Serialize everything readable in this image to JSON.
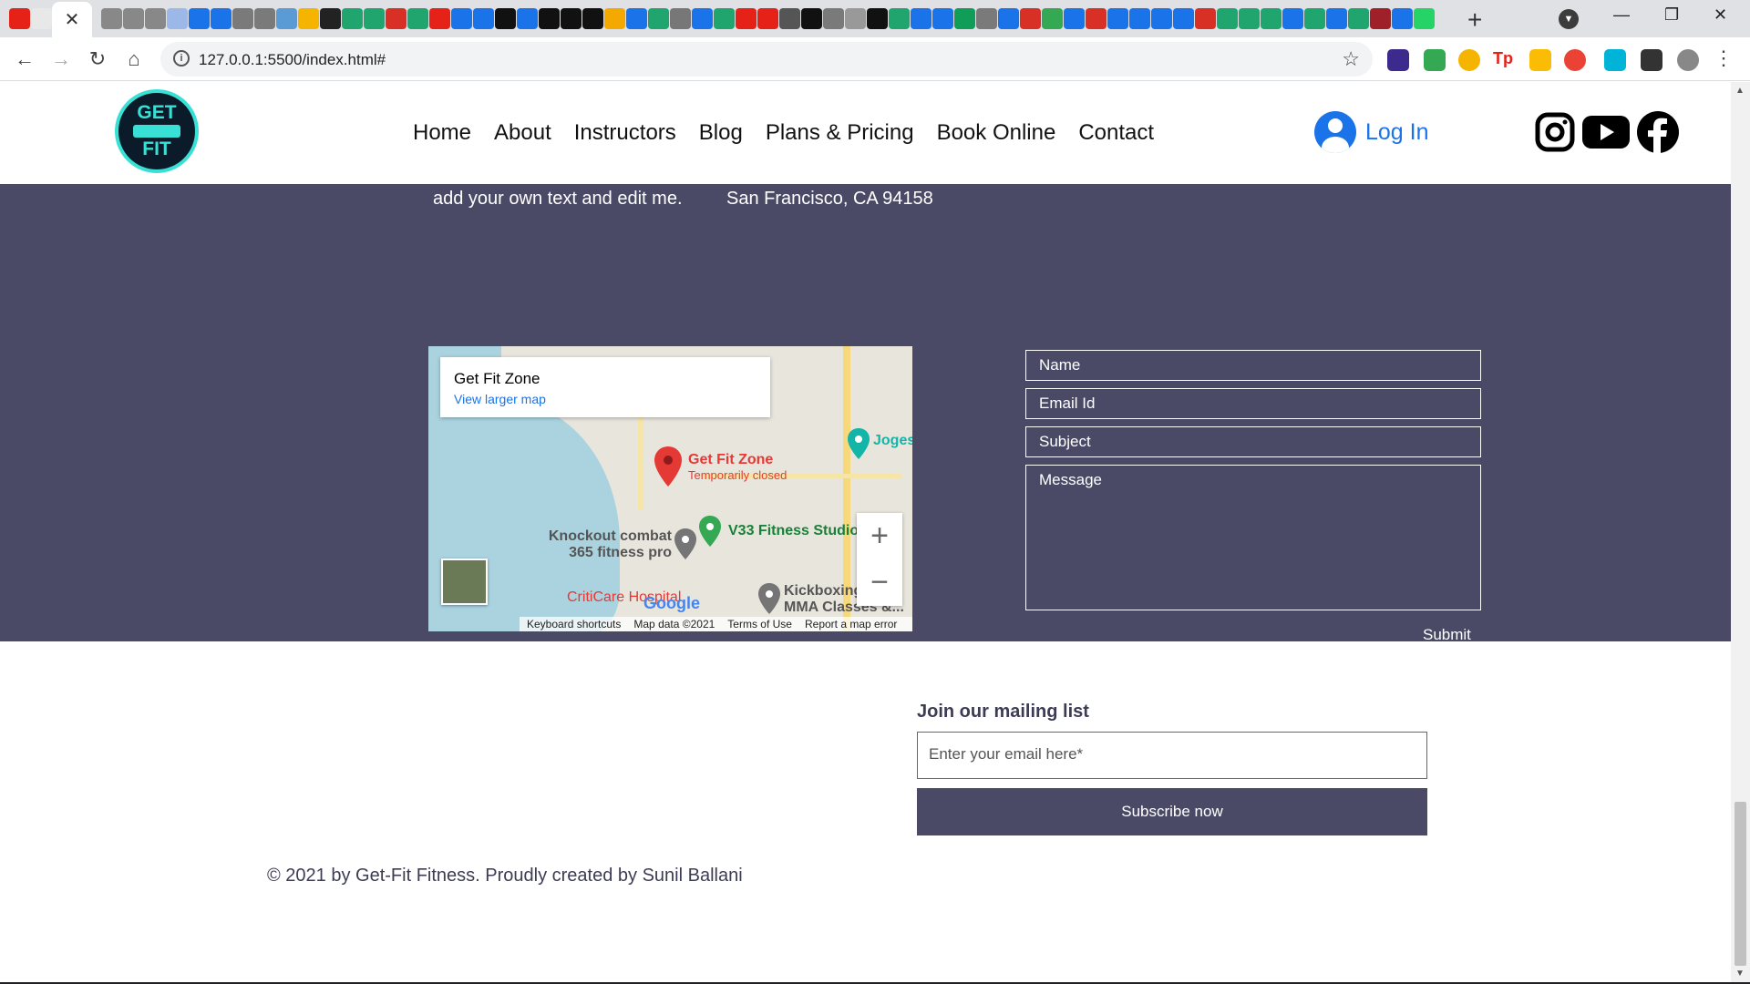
{
  "browser": {
    "active_tab_close": "✕",
    "new_tab": "+",
    "url": "127.0.0.1:5500/index.html#",
    "tab_icon_colors": [
      "#e62117",
      "#e8e8e8",
      "#888",
      "#888",
      "#888",
      "#9bb8e8",
      "#1a73e8",
      "#1a73e8",
      "#7a7a7a",
      "#7a7a7a",
      "#5b9bd5",
      "#f4b400",
      "#222",
      "#21a56f",
      "#21a56f",
      "#d93025",
      "#21a56f",
      "#e62117",
      "#1a73e8",
      "#1a73e8",
      "#111",
      "#1a73e8",
      "#111",
      "#111",
      "#111",
      "#f4a900",
      "#1a73e8",
      "#21a56f",
      "#777",
      "#1a73e8",
      "#21a56f",
      "#e62117",
      "#e62117",
      "#555",
      "#111",
      "#7a7a7a",
      "#999",
      "#111",
      "#21a56f",
      "#1a73e8",
      "#1a73e8",
      "#0f9d58",
      "#7a7a7a",
      "#1a73e8",
      "#d93025",
      "#34a853",
      "#1a73e8",
      "#d93025",
      "#1a73e8",
      "#1a73e8",
      "#1a73e8",
      "#1a73e8",
      "#d93025",
      "#21a56f",
      "#21a56f",
      "#21a56f",
      "#1a73e8",
      "#21a56f",
      "#1a73e8",
      "#21a56f",
      "#a0202a",
      "#1a73e8",
      "#25d366"
    ]
  },
  "site": {
    "logo_top": "GET",
    "logo_bottom": "FIT",
    "nav": [
      "Home",
      "About",
      "Instructors",
      "Blog",
      "Plans & Pricing",
      "Book Online",
      "Contact"
    ],
    "login": "Log In",
    "socials": [
      "instagram-icon",
      "youtube-icon",
      "facebook-icon"
    ]
  },
  "contact": {
    "col1_line": "add your own text and edit me.",
    "col2_line": "San Francisco, CA 94158"
  },
  "map": {
    "place_title": "Get Fit Zone",
    "view_larger": "View larger map",
    "pin_name": "Get Fit Zone",
    "pin_status": "Temporarily closed",
    "poi1": "V33 Fitness Studio",
    "poi2_l1": "Knockout combat",
    "poi2_l2": "365 fitness pro",
    "poi3": "Joges",
    "poi4_l1": "Kickboxing",
    "poi4_l2": "MMA Classes &...",
    "poi5": "CritiCare Hospital",
    "google": "Google",
    "footer": [
      "Keyboard shortcuts",
      "Map data ©2021",
      "Terms of Use",
      "Report a map error"
    ],
    "zoom_in": "+",
    "zoom_out": "−"
  },
  "form": {
    "name": "Name",
    "email": "Email Id",
    "subject": "Subject",
    "message": "Message",
    "submit": "Submit"
  },
  "mailing": {
    "heading": "Join our mailing list",
    "placeholder": "Enter your email here*",
    "button": "Subscribe now"
  },
  "copyright": "© 2021 by Get-Fit Fitness. Proudly created by Sunil Ballani",
  "colors": {
    "accent": "#4a4a66",
    "link": "#1a73e8",
    "logo": "#38e0d6"
  }
}
